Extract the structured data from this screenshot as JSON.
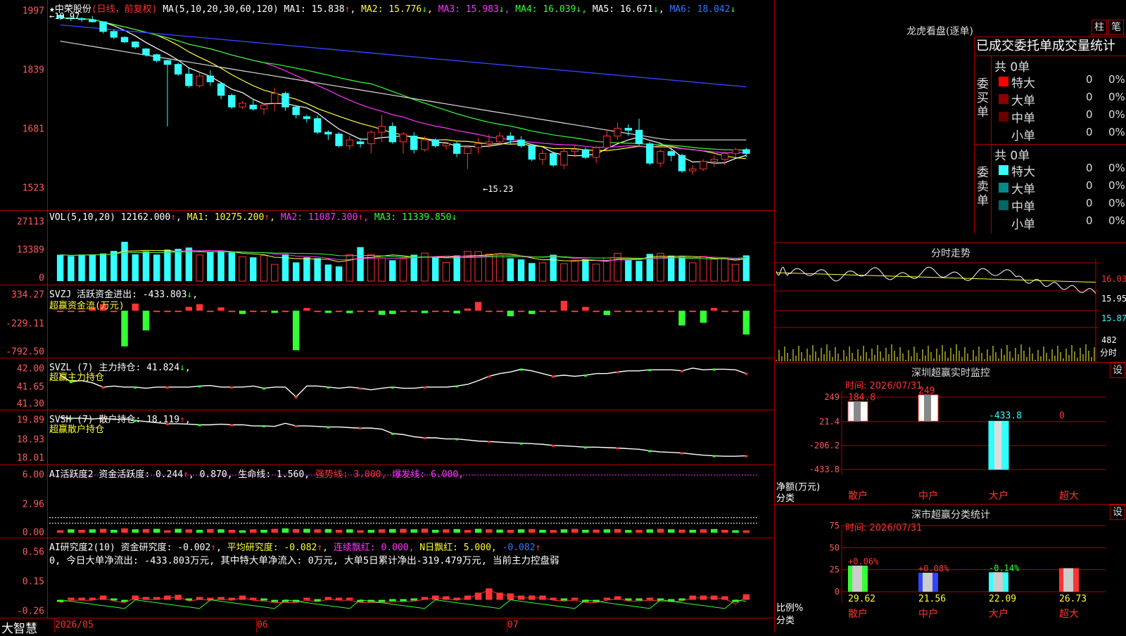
{
  "colors": {
    "up": "#ff3333",
    "down": "#33ffff",
    "frame": "#b00000",
    "axis": "#ff5a5a",
    "ma1": "#ffffff",
    "ma2": "#ffff33",
    "ma3": "#ff33ff",
    "ma4": "#33ff33",
    "ma5": "#dddddd",
    "ma6": "#3344ff"
  },
  "price_pane": {
    "stock_name": "★中荣股份",
    "mode": "(日线，前复权)",
    "ma_params": "MA(5,10,20,30,60,120)",
    "ma": [
      {
        "label": "MA1:",
        "value": "15.838",
        "arrow": "↑"
      },
      {
        "label": "MA2:",
        "value": "15.776",
        "arrow": "↓"
      },
      {
        "label": "MA3:",
        "value": "15.983",
        "arrow": "↓"
      },
      {
        "label": "MA4:",
        "value": "16.039",
        "arrow": "↓"
      },
      {
        "label": "MA5:",
        "value": "16.671",
        "arrow": "↓"
      },
      {
        "label": "MA6:",
        "value": "18.042",
        "arrow": "↓"
      }
    ],
    "hi_label": "←19.97",
    "lo_label": "←15.23",
    "yticks": [
      "1997",
      "1839",
      "1681",
      "1523"
    ]
  },
  "vol_pane": {
    "title": "VOL(5,10,20)",
    "v": "12162.000",
    "arrow": "↑",
    "ma": [
      {
        "label": "MA1:",
        "value": "10275.200",
        "arrow": "↑"
      },
      {
        "label": "MA2:",
        "value": "11087.300",
        "arrow": "↑"
      },
      {
        "label": "MA3:",
        "value": "11339.850",
        "arrow": "↓"
      }
    ],
    "yticks": [
      "27113",
      "13389",
      "0"
    ]
  },
  "svzj_pane": {
    "title": "SVZJ",
    "label": "活跃资金进出:",
    "value": "-433.803",
    "arrow": "↓",
    "sub": "超赢资金流(万元)",
    "yticks": [
      "334.27",
      "-229.11",
      "-792.50"
    ]
  },
  "svzl_pane": {
    "title": "SVZL  (7)",
    "label": "主力持仓:",
    "value": "41.824",
    "arrow": "↓",
    "sub": "超赢主力持仓",
    "yticks": [
      "42.00",
      "41.65",
      "41.30"
    ]
  },
  "svsh_pane": {
    "title": "SVSH  (7)",
    "label": "散户持仓:",
    "value": "18.119",
    "arrow": "↑",
    "sub": "超赢散户持仓",
    "yticks": [
      "19.89",
      "18.93",
      "18.01"
    ]
  },
  "ai_pane": {
    "title": "AI活跃度2",
    "label": "资金活跃度:",
    "v1": "0.244",
    "a1": "↑",
    "v2": "0.870",
    "label2": "生命线:",
    "v3": "1.560",
    "label3": "强势线:",
    "v4": "3.000",
    "label4": "爆发线:",
    "v5": "6.000",
    "yticks": [
      "6.00",
      "2.96",
      "0.00"
    ]
  },
  "research_pane": {
    "title": "AI研究度2(10)",
    "label": "资金研究度:",
    "v1": "-0.002",
    "a1": "↑",
    "label2": "平均研究度:",
    "v2": "-0.082",
    "a2": "↑",
    "label3": "连续飘红:",
    "v3": "0.000",
    "label4": "N日飘红:",
    "v4": "5.000",
    "v5": "-0.082",
    "a5": "↑",
    "note": "0, 今日大单净流出: -433.803万元, 其中特大单净流入: 0万元, 大单5日累计净出-319.479万元, 当前主力控盘弱",
    "yticks": [
      "0.56",
      "0.15",
      "-0.26"
    ]
  },
  "bottom": {
    "logo": "大智慧",
    "dates": [
      "2026/05",
      "06",
      "07"
    ]
  },
  "longhu": {
    "title": "龙虎看盘(逐单)",
    "btn_bar": "柱",
    "btn_pen": "笔",
    "header": "已成交委托单成交量统计",
    "buy_label": "委买单",
    "sell_label": "委卖单",
    "buy_total": "共 0单",
    "sell_total": "共 0单",
    "buy_rows": [
      {
        "name": "特大",
        "vol": "0",
        "pct": "0%",
        "color": "#ff0000"
      },
      {
        "name": "大单",
        "vol": "0",
        "pct": "0%",
        "color": "#8b0000"
      },
      {
        "name": "中单",
        "vol": "0",
        "pct": "0%",
        "color": "#660000"
      },
      {
        "name": "小单",
        "vol": "0",
        "pct": "0%",
        "color": "#000000"
      }
    ],
    "sell_rows": [
      {
        "name": "特大",
        "vol": "0",
        "pct": "0%",
        "color": "#33ffff"
      },
      {
        "name": "大单",
        "vol": "0",
        "pct": "0%",
        "color": "#008b8b"
      },
      {
        "name": "中单",
        "vol": "0",
        "pct": "0%",
        "color": "#006666"
      },
      {
        "name": "小单",
        "vol": "0",
        "pct": "0%",
        "color": "#000000"
      }
    ]
  },
  "intraday": {
    "title": "分时走势",
    "y1": "16.03",
    "y2": "15.95",
    "y3": "15.87",
    "vol": "482",
    "vol_unit": "分时"
  },
  "shenzhen": {
    "title": "深圳超赢实时监控",
    "btn": "设",
    "time": "时间: 2026/07/31",
    "yticks": [
      "249",
      "21.4",
      "-206.2",
      "-433.8"
    ],
    "ylabel": "净额(万元)",
    "xlabel": "分类",
    "bars": [
      {
        "name": "散户",
        "value": 184.8,
        "text": "184.8"
      },
      {
        "name": "中户",
        "value": 249,
        "text": "249"
      },
      {
        "name": "大户",
        "value": -433.8,
        "text": "-433.8"
      },
      {
        "name": "超大",
        "value": 0,
        "text": "0"
      }
    ]
  },
  "market": {
    "title": "深市超赢分类统计",
    "btn": "设",
    "time": "时间: 2026/07/31",
    "yticks": [
      "75",
      "50",
      "25",
      "0"
    ],
    "ylabel": "比例%",
    "xlabel": "分类",
    "bars": [
      {
        "name": "散户",
        "value": 29.62,
        "chg": "+0.06%",
        "text": "29.62"
      },
      {
        "name": "中户",
        "value": 21.56,
        "chg": "+0.08%",
        "text": "21.56"
      },
      {
        "name": "大户",
        "value": 22.09,
        "chg": "-0.14%",
        "text": "22.09"
      },
      {
        "name": "超大",
        "value": 26.73,
        "chg": "",
        "text": "26.73"
      }
    ]
  },
  "chart_data": [
    {
      "type": "candlestick",
      "title": "中荣股份 日线",
      "ylim": [
        15.1,
        20.0
      ],
      "ohlc": [
        [
          19.97,
          19.97,
          19.85,
          19.9
        ],
        [
          19.9,
          19.95,
          19.82,
          19.88
        ],
        [
          19.88,
          19.92,
          19.8,
          19.86
        ],
        [
          19.85,
          19.95,
          19.78,
          19.8
        ],
        [
          19.8,
          19.8,
          19.5,
          19.55
        ],
        [
          19.55,
          19.6,
          19.35,
          19.4
        ],
        [
          19.4,
          19.42,
          19.25,
          19.28
        ],
        [
          19.28,
          19.3,
          19.1,
          19.15
        ],
        [
          19.1,
          19.12,
          18.9,
          18.95
        ],
        [
          18.95,
          18.98,
          18.75,
          18.8
        ],
        [
          18.8,
          18.82,
          17.1,
          18.7
        ],
        [
          18.7,
          18.75,
          18.4,
          18.45
        ],
        [
          18.45,
          18.6,
          18.1,
          18.15
        ],
        [
          18.15,
          18.5,
          18.1,
          18.4
        ],
        [
          18.4,
          18.55,
          18.15,
          18.25
        ],
        [
          18.2,
          18.25,
          17.8,
          17.9
        ],
        [
          17.9,
          17.95,
          17.55,
          17.6
        ],
        [
          17.6,
          17.75,
          17.55,
          17.7
        ],
        [
          17.65,
          17.8,
          17.5,
          17.55
        ],
        [
          17.55,
          17.7,
          17.4,
          17.65
        ],
        [
          17.7,
          18.1,
          17.5,
          17.95
        ],
        [
          17.95,
          18.0,
          17.5,
          17.6
        ],
        [
          17.6,
          17.65,
          17.3,
          17.4
        ],
        [
          17.35,
          17.4,
          17.2,
          17.3
        ],
        [
          17.3,
          17.38,
          16.9,
          16.95
        ],
        [
          16.95,
          17.0,
          16.75,
          16.9
        ],
        [
          16.9,
          16.95,
          16.55,
          16.6
        ],
        [
          16.6,
          16.85,
          16.5,
          16.75
        ],
        [
          16.7,
          16.8,
          16.55,
          16.65
        ],
        [
          16.65,
          17.0,
          16.4,
          16.95
        ],
        [
          16.95,
          17.4,
          16.7,
          17.1
        ],
        [
          17.1,
          17.2,
          16.65,
          16.7
        ],
        [
          16.7,
          16.95,
          16.4,
          16.9
        ],
        [
          16.85,
          16.95,
          16.4,
          16.5
        ],
        [
          16.5,
          16.85,
          16.45,
          16.75
        ],
        [
          16.75,
          16.8,
          16.55,
          16.6
        ],
        [
          16.6,
          16.7,
          16.5,
          16.65
        ],
        [
          16.65,
          16.7,
          16.3,
          16.4
        ],
        [
          16.4,
          16.6,
          16.0,
          16.55
        ],
        [
          16.55,
          16.8,
          16.4,
          16.65
        ],
        [
          16.65,
          16.9,
          16.55,
          16.7
        ],
        [
          16.7,
          16.95,
          16.6,
          16.85
        ],
        [
          16.85,
          16.95,
          16.65,
          16.75
        ],
        [
          16.75,
          16.85,
          16.55,
          16.6
        ],
        [
          16.6,
          16.65,
          16.2,
          16.25
        ],
        [
          16.25,
          16.5,
          16.1,
          16.4
        ],
        [
          16.4,
          16.45,
          16.05,
          16.1
        ],
        [
          16.1,
          16.55,
          16.0,
          16.45
        ],
        [
          16.45,
          16.6,
          16.3,
          16.5
        ],
        [
          16.5,
          16.55,
          16.25,
          16.3
        ],
        [
          16.3,
          16.6,
          16.15,
          16.55
        ],
        [
          16.55,
          17.0,
          16.45,
          16.85
        ],
        [
          16.85,
          17.2,
          16.75,
          17.05
        ],
        [
          17.05,
          17.15,
          16.85,
          17.0
        ],
        [
          17.0,
          17.3,
          16.6,
          16.65
        ],
        [
          16.65,
          16.7,
          16.1,
          16.15
        ],
        [
          16.15,
          16.5,
          16.05,
          16.45
        ],
        [
          16.45,
          16.55,
          16.2,
          16.35
        ],
        [
          16.35,
          16.4,
          15.9,
          15.95
        ],
        [
          15.95,
          16.1,
          15.85,
          16.0
        ],
        [
          16.0,
          16.25,
          15.95,
          16.2
        ],
        [
          16.2,
          16.35,
          16.05,
          16.25
        ],
        [
          16.25,
          16.45,
          16.1,
          16.4
        ],
        [
          16.4,
          16.55,
          16.3,
          16.5
        ],
        [
          16.5,
          16.55,
          16.3,
          16.4
        ]
      ]
    },
    {
      "type": "bar",
      "title": "VOL(5,10,20)",
      "ylim": [
        0,
        27113
      ],
      "values": [
        12400,
        11800,
        12500,
        12600,
        13000,
        14200,
        18500,
        12600,
        14000,
        12500,
        14800,
        15200,
        15800,
        12300,
        13900,
        14000,
        13500,
        11500,
        11200,
        12000,
        7900,
        12700,
        8800,
        11200,
        10800,
        7800,
        6900,
        12500,
        16000,
        12500,
        10800,
        9800,
        10600,
        12400,
        13200,
        11200,
        8800,
        12100,
        14000,
        13900,
        12700,
        12200,
        10700,
        10200,
        8500,
        8600,
        12400,
        8200,
        9700,
        10200,
        8000,
        10900,
        13100,
        10100,
        9500,
        12800,
        13100,
        12000,
        11400,
        8600,
        11600,
        10300,
        10800,
        7900,
        12100
      ]
    },
    {
      "type": "bar",
      "title": "SVZJ",
      "ylim": [
        -792.5,
        334.27
      ],
      "values": [
        0,
        0,
        0,
        60,
        120,
        0,
        -650,
        130,
        -360,
        0,
        0,
        0,
        70,
        120,
        0,
        60,
        0,
        -60,
        0,
        0,
        -40,
        0,
        -720,
        50,
        0,
        -40,
        0,
        -45,
        0,
        0,
        -75,
        -60,
        0,
        0,
        -45,
        0,
        0,
        -50,
        40,
        160,
        0,
        0,
        -100,
        0,
        -60,
        0,
        0,
        180,
        0,
        70,
        0,
        -80,
        0,
        0,
        0,
        0,
        0,
        0,
        -270,
        0,
        -220,
        50,
        0,
        0,
        -433.8
      ]
    },
    {
      "type": "line",
      "title": "SVZL",
      "ylim": [
        41.3,
        42.0
      ],
      "values": [
        41.82,
        41.7,
        41.72,
        41.68,
        41.6,
        41.62,
        41.6,
        41.6,
        41.58,
        41.6,
        41.6,
        41.6,
        41.6,
        41.62,
        41.63,
        41.6,
        41.6,
        41.6,
        41.62,
        41.58,
        41.6,
        41.6,
        41.42,
        41.62,
        41.62,
        41.6,
        41.58,
        41.6,
        41.58,
        41.55,
        41.58,
        41.6,
        41.58,
        41.58,
        41.6,
        41.6,
        41.6,
        41.62,
        41.65,
        41.72,
        41.8,
        41.85,
        41.88,
        41.93,
        41.9,
        41.85,
        41.8,
        41.82,
        41.8,
        41.82,
        41.85,
        41.85,
        41.88,
        41.9,
        41.9,
        41.92,
        41.92,
        41.92,
        41.9,
        41.95,
        41.92,
        41.93,
        41.93,
        41.92,
        41.85
      ]
    },
    {
      "type": "line",
      "title": "SVSH",
      "ylim": [
        18.01,
        19.89
      ],
      "values": [
        19.89,
        19.85,
        19.85,
        19.82,
        19.85,
        19.8,
        19.82,
        19.75,
        19.7,
        19.65,
        19.6,
        19.6,
        19.58,
        19.55,
        19.55,
        19.58,
        19.55,
        19.55,
        19.5,
        19.5,
        19.48,
        19.62,
        19.5,
        19.5,
        19.48,
        19.45,
        19.45,
        19.42,
        19.4,
        19.4,
        19.35,
        19.15,
        19.1,
        19.0,
        18.95,
        18.95,
        18.9,
        18.9,
        18.85,
        18.8,
        18.78,
        18.75,
        18.72,
        18.7,
        18.68,
        18.65,
        18.6,
        18.58,
        18.55,
        18.52,
        18.52,
        18.5,
        18.48,
        18.45,
        18.42,
        18.35,
        18.3,
        18.28,
        18.25,
        18.2,
        18.15,
        18.12,
        18.1,
        18.1,
        18.12
      ]
    },
    {
      "type": "bar",
      "title": "AI活跃度2",
      "ylim": [
        0,
        6.0
      ],
      "values": [
        0.25,
        0.35,
        0.3,
        0.35,
        0.4,
        0.3,
        0.45,
        0.35,
        0.38,
        0.4,
        0.25,
        0.4,
        0.35,
        0.3,
        0.38,
        0.35,
        0.3,
        0.25,
        0.35,
        0.3,
        0.4,
        0.45,
        0.38,
        0.4,
        0.35,
        0.38,
        0.3,
        0.35,
        0.25,
        0.3,
        0.35,
        0.38,
        0.4,
        0.35,
        0.42,
        0.3,
        0.35,
        0.38,
        0.28,
        0.4,
        0.35,
        0.32,
        0.3,
        0.35,
        0.38,
        0.3,
        0.28,
        0.35,
        0.4,
        0.3,
        0.32,
        0.35,
        0.38,
        0.28,
        0.3,
        0.35,
        0.4,
        0.35,
        0.32,
        0.3,
        0.35,
        0.38,
        0.3,
        0.25,
        0.244
      ]
    },
    {
      "type": "bar",
      "title": "AI研究度2(10)",
      "ylim": [
        -0.26,
        0.56
      ],
      "values": [
        -0.08,
        -0.05,
        -0.05,
        -0.05,
        -0.02,
        -0.06,
        -0.08,
        -0.02,
        -0.04,
        -0.04,
        -0.02,
        -0.01,
        -0.06,
        -0.04,
        -0.05,
        -0.04,
        -0.05,
        -0.02,
        -0.05,
        -0.06,
        -0.08,
        -0.08,
        -0.08,
        -0.05,
        -0.07,
        -0.04,
        -0.05,
        -0.05,
        -0.08,
        -0.08,
        -0.08,
        -0.07,
        -0.07,
        -0.06,
        -0.04,
        -0.02,
        -0.03,
        -0.05,
        -0.02,
        0.02,
        0.08,
        0.02,
        0.01,
        -0.02,
        -0.02,
        -0.02,
        -0.05,
        -0.06,
        -0.05,
        -0.08,
        -0.08,
        -0.05,
        -0.03,
        -0.06,
        -0.06,
        -0.05,
        -0.06,
        -0.07,
        -0.06,
        -0.02,
        -0.02,
        -0.02,
        -0.03,
        -0.1,
        -0.002
      ]
    }
  ]
}
